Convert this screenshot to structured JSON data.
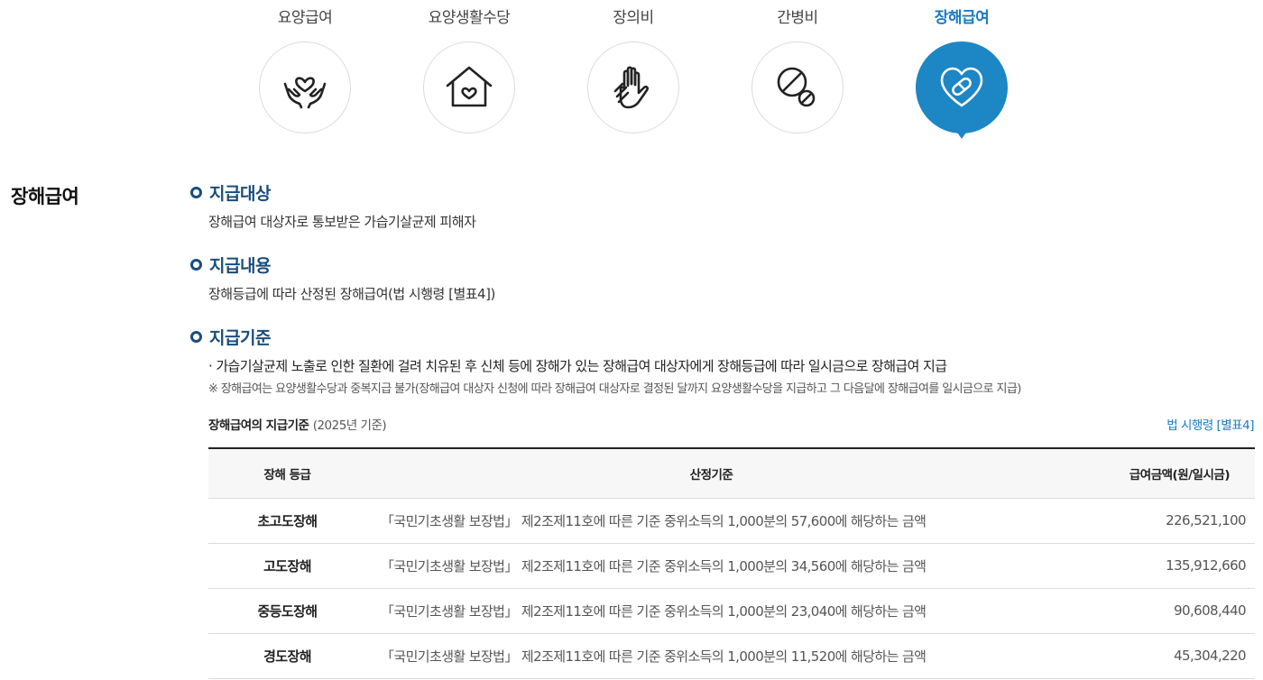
{
  "tabs": [
    {
      "label": "요양급여",
      "icon": "hands-heart-icon",
      "active": false
    },
    {
      "label": "요양생활수당",
      "icon": "house-heart-icon",
      "active": false
    },
    {
      "label": "장의비",
      "icon": "hand-icon",
      "active": false
    },
    {
      "label": "간병비",
      "icon": "pills-icon",
      "active": false
    },
    {
      "label": "장해급여",
      "icon": "heart-bandage-icon",
      "active": true
    }
  ],
  "colors": {
    "accent": "#1d86c4",
    "heading": "#1a4d7c",
    "link": "#1b7ac0"
  },
  "page_title": "장해급여",
  "sections": {
    "target": {
      "heading": "지급대상",
      "body": "장해급여 대상자로 통보받은 가습기살균제 피해자"
    },
    "content": {
      "heading": "지급내용",
      "body": "장해등급에 따라 산정된 장해급여(법 시행령 [별표4])"
    },
    "criteria": {
      "heading": "지급기준",
      "line": "· 가습기살균제 노출로 인한 질환에 걸려 치유된 후 신체 등에 장해가 있는 장해급여 대상자에게 장해등급에 따라 일시금으로 장해급여 지급",
      "note": "※ 장해급여는 요양생활수당과 중복지급 불가(장해급여 대상자 신청에 따라 장해급여 대상자로 결정된 달까지 요양생활수당을 지급하고 그 다음달에 장해급여를 일시금으로 지급)"
    }
  },
  "table": {
    "caption": "장해급여의 지급기준",
    "caption_year": "(2025년 기준)",
    "law_link": "법 시행령 [별표4]",
    "headers": [
      "장해 등급",
      "산정기준",
      "급여금액(원/일시금)"
    ],
    "rows": [
      [
        "초고도장해",
        "「국민기초생활 보장법」 제2조제11호에 따른 기준 중위소득의 1,000분의 57,600에 해당하는 금액",
        "226,521,100"
      ],
      [
        "고도장해",
        "「국민기초생활 보장법」 제2조제11호에 따른 기준 중위소득의 1,000분의 34,560에 해당하는 금액",
        "135,912,660"
      ],
      [
        "중등도장해",
        "「국민기초생활 보장법」 제2조제11호에 따른 기준 중위소득의 1,000분의 23,040에 해당하는 금액",
        "90,608,440"
      ],
      [
        "경도장해",
        "「국민기초생활 보장법」 제2조제11호에 따른 기준 중위소득의 1,000분의 11,520에 해당하는 금액",
        "45,304,220"
      ]
    ]
  }
}
